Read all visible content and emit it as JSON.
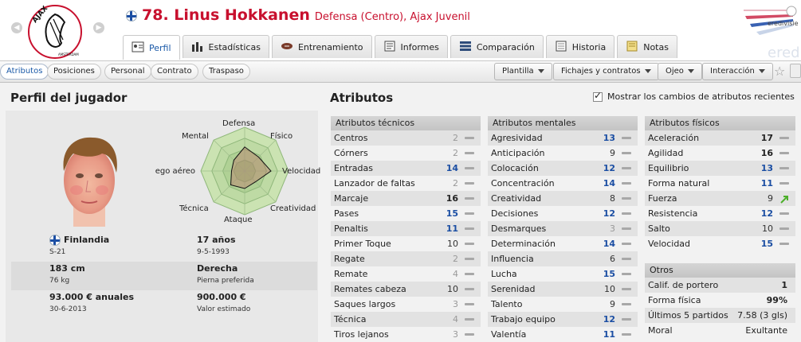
{
  "header": {
    "title": "78. Linus Hokkanen",
    "subtitle": "Defensa (Centro), Ajax Juvenil",
    "tabs": [
      {
        "label": "Perfil",
        "icon": "profile-card-icon",
        "active": true
      },
      {
        "label": "Estadísticas",
        "icon": "bar-stats-icon",
        "active": false
      },
      {
        "label": "Entrenamiento",
        "icon": "rugby-ball-icon",
        "active": false
      },
      {
        "label": "Informes",
        "icon": "report-icon",
        "active": false
      },
      {
        "label": "Comparación",
        "icon": "compare-icon",
        "active": false
      },
      {
        "label": "Historia",
        "icon": "history-icon",
        "active": false
      },
      {
        "label": "Notas",
        "icon": "notes-icon",
        "active": false
      }
    ],
    "league_logo_text": "eredivisie",
    "league_logo_bg_text": "eredivisie"
  },
  "subtabs": [
    {
      "label": "Atributos",
      "active": true
    },
    {
      "label": "Posiciones",
      "active": false
    },
    {
      "label": "Personal",
      "active": false
    },
    {
      "label": "Contrato",
      "active": false
    },
    {
      "label": "Traspaso",
      "active": false
    }
  ],
  "menus": [
    "Plantilla",
    "Fichajes y contratos",
    "Ojeo",
    "Interacción"
  ],
  "profile": {
    "section_title": "Perfil del jugador",
    "radar_labels": {
      "top": "Defensa",
      "top_right": "Físico",
      "right": "Velocidad",
      "bottom_right": "Creatividad",
      "bottom": "Ataque",
      "bottom_left": "Técnica",
      "left": "Juego aéreo",
      "top_left": "Mental"
    },
    "radar_values": [
      0.55,
      0.45,
      0.6,
      0.35,
      0.4,
      0.45,
      0.3,
      0.35
    ],
    "info": [
      {
        "v1": "Finlandia",
        "s1": "S-21",
        "v2": "17 años",
        "s2": "9-5-1993"
      },
      {
        "v1": "183 cm",
        "s1": "76 kg",
        "v2": "Derecha",
        "s2": "Pierna preferida"
      },
      {
        "v1": "93.000 € anuales",
        "s1": "30-6-2013",
        "v2": "900.000 €",
        "s2": "Valor estimado"
      }
    ]
  },
  "attributes": {
    "section_title": "Atributos",
    "show_changes_label": "Mostrar los cambios de atributos recientes",
    "technical": {
      "title": "Atributos técnicos",
      "rows": [
        {
          "label": "Centros",
          "value": "2"
        },
        {
          "label": "Córners",
          "value": "2"
        },
        {
          "label": "Entradas",
          "value": "14"
        },
        {
          "label": "Lanzador de faltas",
          "value": "2"
        },
        {
          "label": "Marcaje",
          "value": "16"
        },
        {
          "label": "Pases",
          "value": "15"
        },
        {
          "label": "Penaltis",
          "value": "11"
        },
        {
          "label": "Primer Toque",
          "value": "10"
        },
        {
          "label": "Regate",
          "value": "2"
        },
        {
          "label": "Remate",
          "value": "4"
        },
        {
          "label": "Remates cabeza",
          "value": "10"
        },
        {
          "label": "Saques largos",
          "value": "3"
        },
        {
          "label": "Técnica",
          "value": "4"
        },
        {
          "label": "Tiros lejanos",
          "value": "3"
        }
      ]
    },
    "mental": {
      "title": "Atributos mentales",
      "rows": [
        {
          "label": "Agresividad",
          "value": "13"
        },
        {
          "label": "Anticipación",
          "value": "9"
        },
        {
          "label": "Colocación",
          "value": "12"
        },
        {
          "label": "Concentración",
          "value": "14"
        },
        {
          "label": "Creatividad",
          "value": "8"
        },
        {
          "label": "Decisiones",
          "value": "12"
        },
        {
          "label": "Desmarques",
          "value": "3"
        },
        {
          "label": "Determinación",
          "value": "14"
        },
        {
          "label": "Influencia",
          "value": "6"
        },
        {
          "label": "Lucha",
          "value": "15"
        },
        {
          "label": "Serenidad",
          "value": "10"
        },
        {
          "label": "Talento",
          "value": "9"
        },
        {
          "label": "Trabajo equipo",
          "value": "12"
        },
        {
          "label": "Valentía",
          "value": "11"
        }
      ]
    },
    "physical": {
      "title": "Atributos físicos",
      "rows": [
        {
          "label": "Aceleración",
          "value": "17"
        },
        {
          "label": "Agilidad",
          "value": "16"
        },
        {
          "label": "Equilibrio",
          "value": "13"
        },
        {
          "label": "Forma natural",
          "value": "11"
        },
        {
          "label": "Fuerza",
          "value": "9",
          "trend": "up"
        },
        {
          "label": "Resistencia",
          "value": "12"
        },
        {
          "label": "Salto",
          "value": "10"
        },
        {
          "label": "Velocidad",
          "value": "15"
        }
      ]
    },
    "others": {
      "title": "Otros",
      "rows": [
        {
          "label": "Calif. de portero",
          "value": "1"
        },
        {
          "label": "Forma física",
          "value": "99%"
        },
        {
          "label": "Últimos 5 partidos",
          "value": "7.58 (3 gls)"
        },
        {
          "label": "Moral",
          "value": "Exultante"
        }
      ]
    }
  },
  "colors": {
    "accent_red": "#c8102e",
    "attr_blue": "#1b4ea3",
    "trend_green": "#4caf2a"
  }
}
